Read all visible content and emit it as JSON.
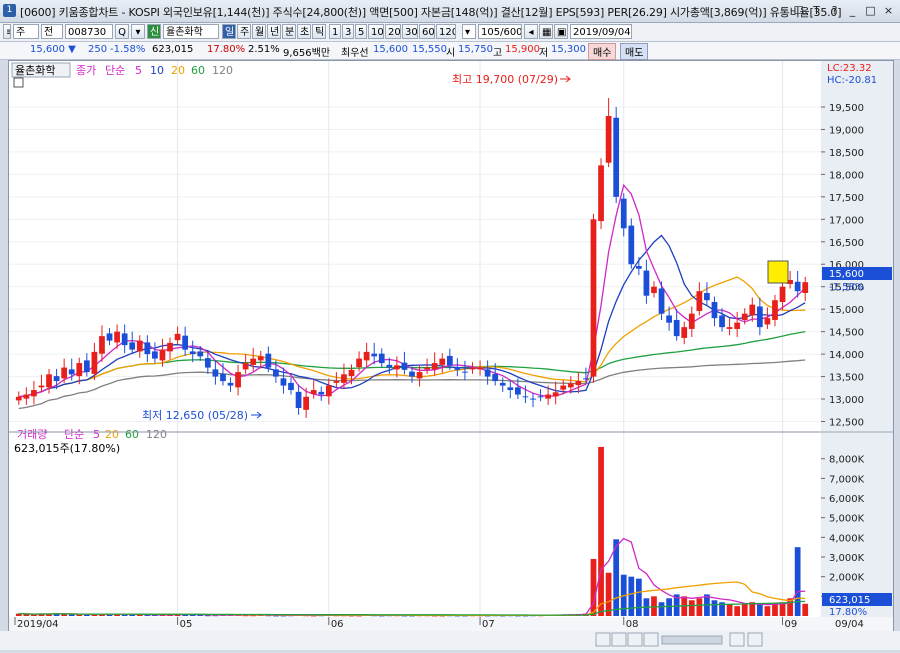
{
  "window": {
    "icon": "1",
    "title": "[0600] 키움종합차트 - KOSPI 외국인보유[1,144(천)] 주식수[24,800(천)] 액면[500] 자본금[148(억)] 결산[12월] EPS[593] PER[26.29] 시가총액[3,869(억)] 유통비율[35.0]",
    "controls": [
      "☐",
      "T",
      "?",
      "_",
      "□",
      "×"
    ]
  },
  "toolbar": {
    "items": [
      "주",
      "전",
      "008730",
      "Q",
      "신",
      "율촌화학",
      "일",
      "주",
      "월",
      "년",
      "분",
      "초",
      "틱",
      "1",
      "3",
      "5",
      "10",
      "20",
      "30",
      "60",
      "120",
      "105/600",
      "2019/09/04"
    ]
  },
  "quote": {
    "price": "15,600 ▼",
    "change": "250",
    "change_pct": "-1.58%",
    "volume": "623,015",
    "turnover": "17.80%",
    "rate": "2.51%",
    "amount": "9,656백만",
    "best_label": "최우선",
    "best_sell": "15,600",
    "best_buy": "15,550",
    "open_label": "시",
    "open": "15,750",
    "high_label": "고",
    "high": "15,900",
    "low_label": "저",
    "low": "15,300",
    "buy_btn": "매수",
    "sell_btn": "매도"
  },
  "legend": {
    "name": "율촌화학",
    "close": "종가",
    "simple": "단순",
    "ma": [
      "5",
      "10",
      "20",
      "60",
      "120"
    ],
    "ma_colors": [
      "#d028c8",
      "#1f3fc0",
      "#f0a000",
      "#20a040",
      "#808080"
    ]
  },
  "volume_legend": {
    "title": "거래량",
    "simple": "단순",
    "ma": [
      "5",
      "20",
      "60",
      "120"
    ],
    "value": "623,015주(17.80%)"
  },
  "annotations": {
    "high": "최고 19,700 (07/29)",
    "low": "최저 12,650 (05/28)"
  },
  "price_axis": {
    "lc": "LC:23.32",
    "hc": "HC:-20.81",
    "ticks": [
      "19,500",
      "19,000",
      "18,500",
      "18,000",
      "17,500",
      "17,000",
      "16,500",
      "16,000",
      "15,500",
      "15,000",
      "14,500",
      "14,000",
      "13,500",
      "13,000",
      "12,500"
    ],
    "current": "15,600",
    "current_pct": "-1.58%"
  },
  "volume_axis": {
    "ticks": [
      "8,000K",
      "7,000K",
      "6,000K",
      "5,000K",
      "4,000K",
      "3,000K",
      "2,000K",
      "1,000K"
    ],
    "current": "623,015",
    "current_pct": "17.80%"
  },
  "date_axis": [
    "2019/04",
    "05",
    "06",
    "07",
    "08",
    "09",
    "09/04"
  ],
  "colors": {
    "up": "#e8201c",
    "down": "#1c4fd8",
    "ma5": "#d028c8",
    "ma10": "#1f3fc0",
    "ma20": "#f0a000",
    "ma60": "#20a040",
    "ma120": "#808080"
  },
  "chart_data": {
    "type": "candlestick",
    "ohlc_close_approx": [
      13050,
      13100,
      13200,
      13300,
      13550,
      13400,
      13700,
      13550,
      13800,
      13600,
      14050,
      14400,
      14300,
      14500,
      14200,
      14100,
      14300,
      14000,
      13900,
      14100,
      14250,
      14450,
      14100,
      14000,
      13950,
      13700,
      13500,
      13400,
      13300,
      13600,
      13800,
      13900,
      13950,
      13700,
      13500,
      13300,
      13200,
      12800,
      13050,
      13200,
      13100,
      13300,
      13400,
      13550,
      13650,
      13900,
      14050,
      13950,
      13800,
      13700,
      13750,
      13650,
      13500,
      13600,
      13700,
      13800,
      13900,
      13750,
      13650,
      13600,
      13700,
      13700,
      13500,
      13400,
      13300,
      13200,
      13100,
      13050,
      13000,
      13050,
      13100,
      13150,
      13300,
      13350,
      13400,
      13450,
      17000,
      18200,
      19300,
      17500,
      16800,
      16000,
      15900,
      15300,
      15500,
      14900,
      14700,
      14400,
      14600,
      14900,
      15400,
      15200,
      14800,
      14600,
      14600,
      14700,
      14900,
      15100,
      14600,
      14800,
      15200,
      15500,
      15650,
      15400,
      15600
    ],
    "volume_k": [
      120,
      90,
      80,
      110,
      100,
      150,
      90,
      80,
      70,
      80,
      90,
      100,
      110,
      90,
      80,
      70,
      60,
      50,
      60,
      70,
      80,
      90,
      70,
      60,
      50,
      40,
      40,
      50,
      60,
      50,
      40,
      40,
      50,
      40,
      30,
      30,
      40,
      50,
      40,
      30,
      40,
      50,
      40,
      40,
      30,
      30,
      50,
      40,
      30,
      40,
      40,
      30,
      30,
      40,
      40,
      30,
      30,
      40,
      30,
      30,
      40,
      40,
      30,
      40,
      30,
      40,
      30,
      30,
      40,
      40,
      60,
      70,
      60,
      80,
      90,
      120,
      2900,
      8600,
      2200,
      3900,
      2100,
      2000,
      1900,
      900,
      1000,
      700,
      900,
      1100,
      1000,
      800,
      900,
      1100,
      800,
      700,
      600,
      500,
      600,
      700,
      600,
      500,
      600,
      700,
      900,
      3500,
      623
    ]
  }
}
